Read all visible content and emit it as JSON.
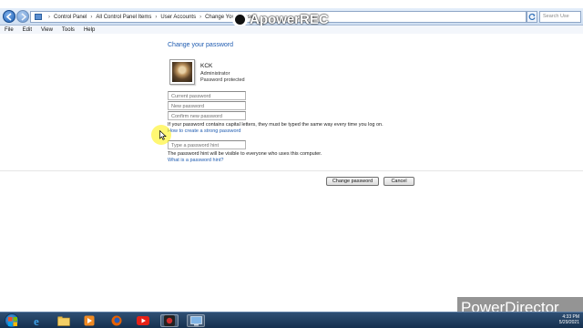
{
  "address_bar": {
    "crumbs": [
      "Control Panel",
      "All Control Panel Items",
      "User Accounts",
      "Change Your Passw"
    ],
    "search_placeholder": "Search Use"
  },
  "watermark": {
    "text": "ApowerREC"
  },
  "menu": [
    "File",
    "Edit",
    "View",
    "Tools",
    "Help"
  ],
  "page": {
    "heading": "Change your password",
    "user": {
      "name": "KCK",
      "role": "Administrator",
      "status": "Password protected"
    },
    "fields": {
      "current_placeholder": "Current password",
      "new_placeholder": "New password",
      "confirm_placeholder": "Confirm new password",
      "hint_placeholder": "Type a password hint"
    },
    "caps_note": "If your password contains capital letters, they must be typed the same way every time you log on.",
    "strong_link": "How to create a strong password",
    "hint_note": "The password hint will be visible to everyone who uses this computer.",
    "hint_link": "What is a password hint?",
    "change_button": "Change password",
    "cancel_button": "Cancel"
  },
  "powerdirector": {
    "text": "PowerDirector"
  },
  "taskbar": {
    "apps": [
      "internet-explorer-icon",
      "file-explorer-icon",
      "media-player-icon",
      "firefox-icon",
      "youtube-icon",
      "recorder-icon",
      "control-panel-icon"
    ],
    "time": "4:33 PM",
    "date": "5/29/2021"
  },
  "colors": {
    "link": "#1e5bb0",
    "taskbar": "#1d3a5c"
  }
}
